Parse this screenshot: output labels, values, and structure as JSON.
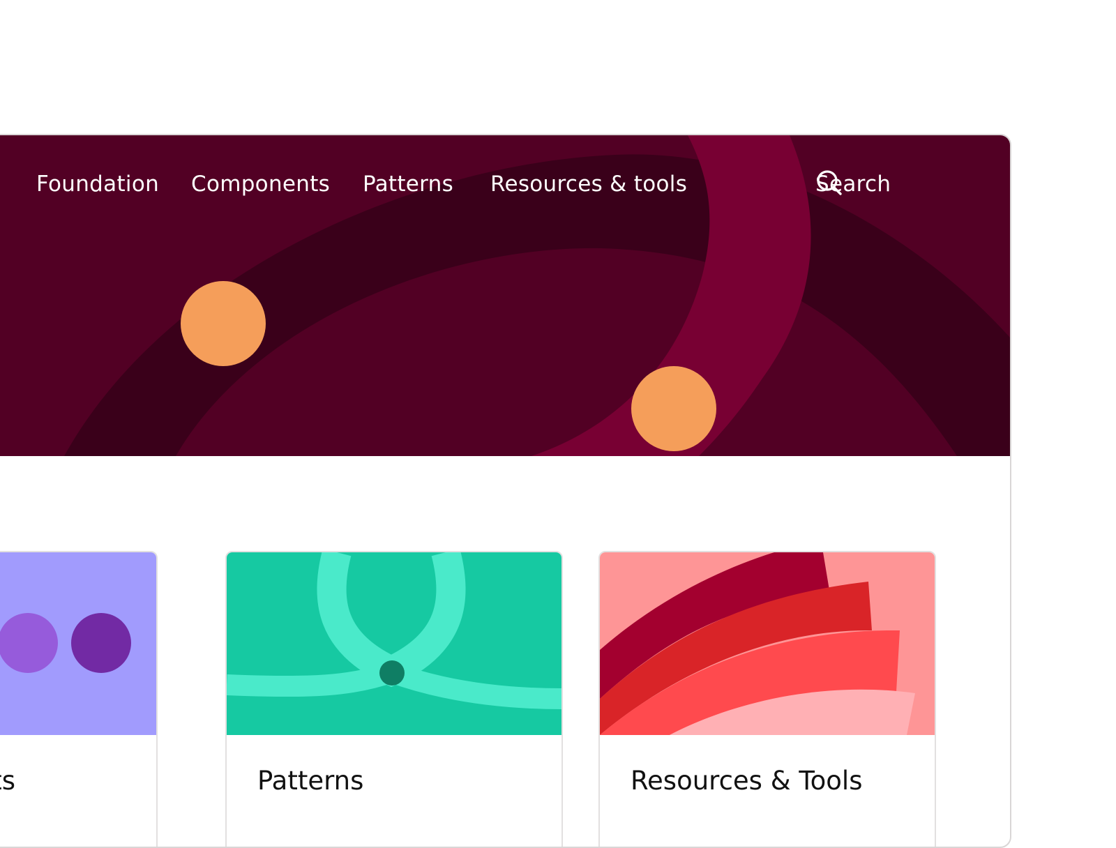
{
  "nav": {
    "items": [
      {
        "label": "Foundation"
      },
      {
        "label": "Components"
      },
      {
        "label": "Patterns"
      },
      {
        "label": "Resources & tools"
      }
    ],
    "search_label": "Search"
  },
  "cards": [
    {
      "title": "Components",
      "color": "#a19bfd"
    },
    {
      "title": "Patterns",
      "color": "#16c9a2"
    },
    {
      "title": "Resources & Tools",
      "color": "#fe9596"
    }
  ],
  "colors": {
    "hero_bg": "#520024",
    "hero_band_dark": "#3a001a",
    "hero_arc": "#780033",
    "hero_dot": "#f59e5a",
    "nav_text": "#ffffff"
  },
  "icons": {
    "search": "search-icon"
  }
}
